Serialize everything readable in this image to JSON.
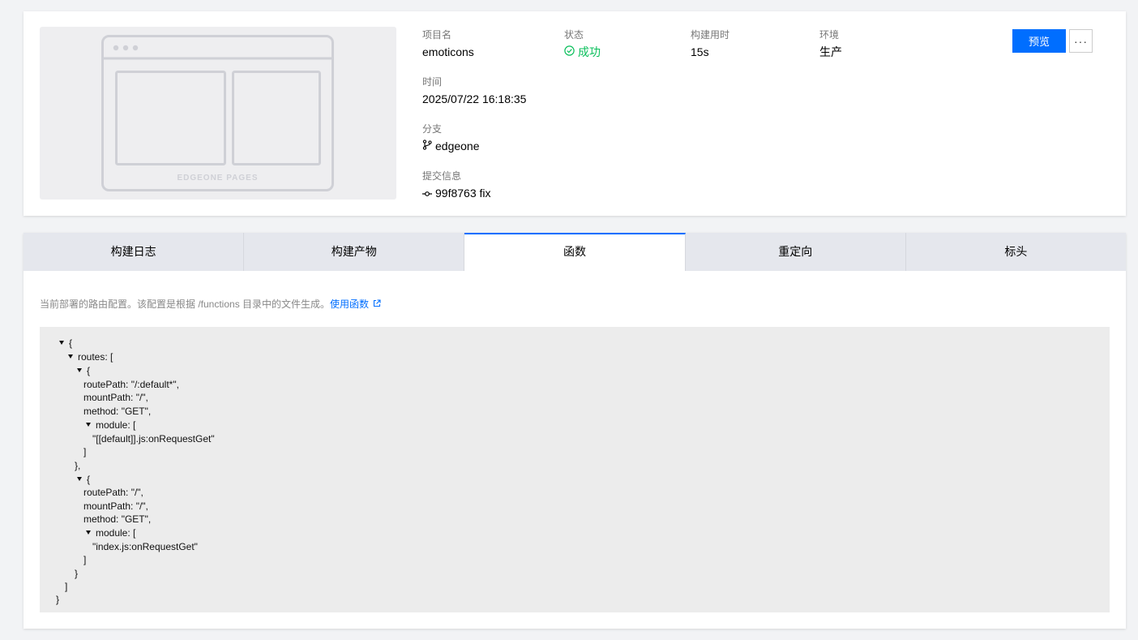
{
  "info": {
    "thumbnail_text": "EDGEONE PAGES",
    "project": {
      "label": "项目名",
      "value": "emoticons"
    },
    "status": {
      "label": "状态",
      "value": "成功"
    },
    "build_duration": {
      "label": "构建用时",
      "value": "15s"
    },
    "environment": {
      "label": "环境",
      "value": "生产"
    },
    "time": {
      "label": "时间",
      "value": "2025/07/22 16:18:35"
    },
    "branch": {
      "label": "分支",
      "value": "edgeone"
    },
    "commit": {
      "label": "提交信息",
      "value": "99f8763 fix"
    },
    "preview_button": "预览",
    "more_button": "···"
  },
  "tabs": [
    {
      "label": "构建日志",
      "active": false
    },
    {
      "label": "构建产物",
      "active": false
    },
    {
      "label": "函数",
      "active": true
    },
    {
      "label": "重定向",
      "active": false
    },
    {
      "label": "标头",
      "active": false
    }
  ],
  "functions": {
    "description": "当前部署的路由配置。该配置是根据 /functions 目录中的文件生成。",
    "link_text": "使用函数",
    "json_lines": [
      "{",
      "routes: [",
      "{",
      "routePath: \"/:default*\",",
      "mountPath: \"/\",",
      "method: \"GET\",",
      "module: [",
      "\"[[default]].js:onRequestGet\"",
      "]",
      "},",
      "{",
      "routePath: \"/\",",
      "mountPath: \"/\",",
      "method: \"GET\",",
      "module: [",
      "\"index.js:onRequestGet\"",
      "]",
      "}",
      "]",
      "}"
    ]
  },
  "colors": {
    "accent": "#006eff",
    "success": "#0abf5b",
    "background": "#f2f3f5"
  }
}
